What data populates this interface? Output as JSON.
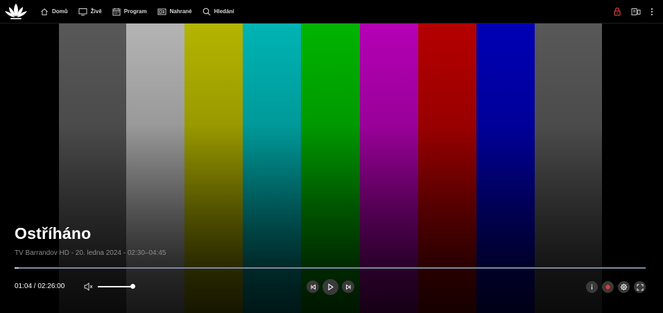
{
  "nav": {
    "items": [
      {
        "label": "Domů",
        "icon": "home-icon"
      },
      {
        "label": "Živě",
        "icon": "tv-icon"
      },
      {
        "label": "Program",
        "icon": "calendar-icon"
      },
      {
        "label": "Nahrané",
        "icon": "recordings-icon"
      },
      {
        "label": "Hledání",
        "icon": "search-icon"
      }
    ]
  },
  "top_right_icons": [
    "lock-icon",
    "cast-icon",
    "more-vertical-icon"
  ],
  "colors": {
    "lock": "#e23b3b",
    "record": "#e23b3b",
    "nav_text": "#d8d8d8",
    "subtitle": "#8c8c8c"
  },
  "test_bars": [
    "#585858",
    "#b4b4b4",
    "#b4b400",
    "#00b4b4",
    "#00b400",
    "#b400b4",
    "#b40000",
    "#0000b4",
    "#585858"
  ],
  "program": {
    "title": "Ostříháno",
    "subtitle": "TV Barrandov HD - 20. ledna 2024 - 02:30–04:45"
  },
  "player": {
    "time": "01:04 / 02:26:00",
    "progress_fraction": 0.007,
    "volume_fraction": 1.0,
    "controls_center": [
      "previous-icon",
      "play-icon",
      "next-icon"
    ],
    "controls_right": [
      "info-icon",
      "record-icon",
      "settings-icon",
      "fullscreen-icon"
    ]
  }
}
